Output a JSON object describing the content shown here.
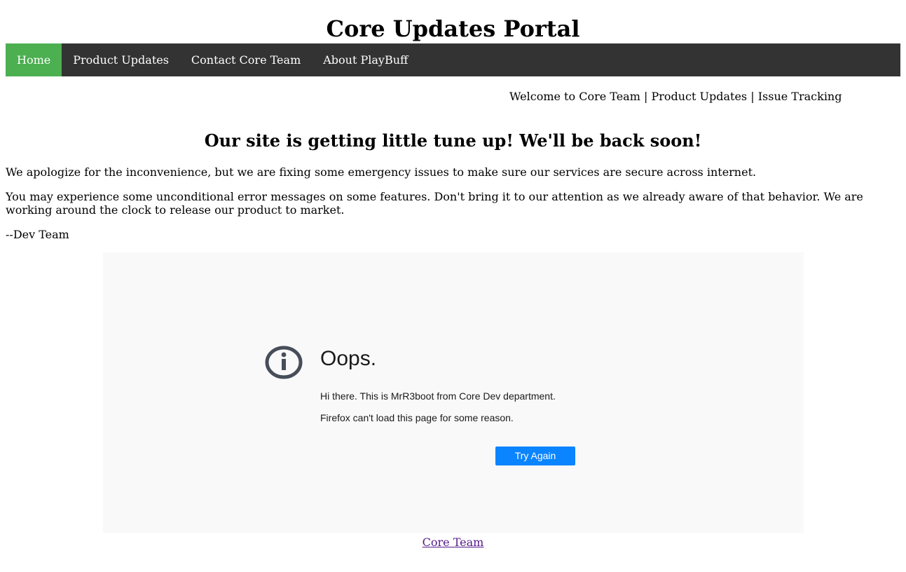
{
  "site": {
    "title": "Core Updates Portal"
  },
  "nav": {
    "items": [
      {
        "label": "Home",
        "active": true
      },
      {
        "label": "Product Updates",
        "active": false
      },
      {
        "label": "Contact Core Team",
        "active": false
      },
      {
        "label": "About PlayBuff",
        "active": false
      }
    ]
  },
  "welcome": {
    "text": "Welcome to Core Team | Product Updates | Issue Tracking"
  },
  "notice": {
    "heading": "Our site is getting little tune up! We'll be back soon!",
    "paragraph1": "We apologize for the inconvenience, but we are fixing some emergency issues to make sure our services are secure across internet.",
    "paragraph2": "You may experience some unconditional error messages on some features. Don't bring it to our attention as we already aware of that behavior. We are working around the clock to release our product to market.",
    "signature": "--Dev Team"
  },
  "error_panel": {
    "icon": "info-icon",
    "title": "Oops.",
    "line1": "Hi there. This is MrR3boot from Core Dev department.",
    "line2": "Firefox can't load this page for some reason.",
    "button_label": "Try Again"
  },
  "footer": {
    "link_text": "Core Team"
  },
  "colors": {
    "nav_background": "#333333",
    "nav_active": "#4caf50",
    "button_blue": "#0a84ff",
    "panel_background": "#f9f9f9",
    "icon_color": "#474e5a",
    "visited_link": "#551a8b"
  }
}
